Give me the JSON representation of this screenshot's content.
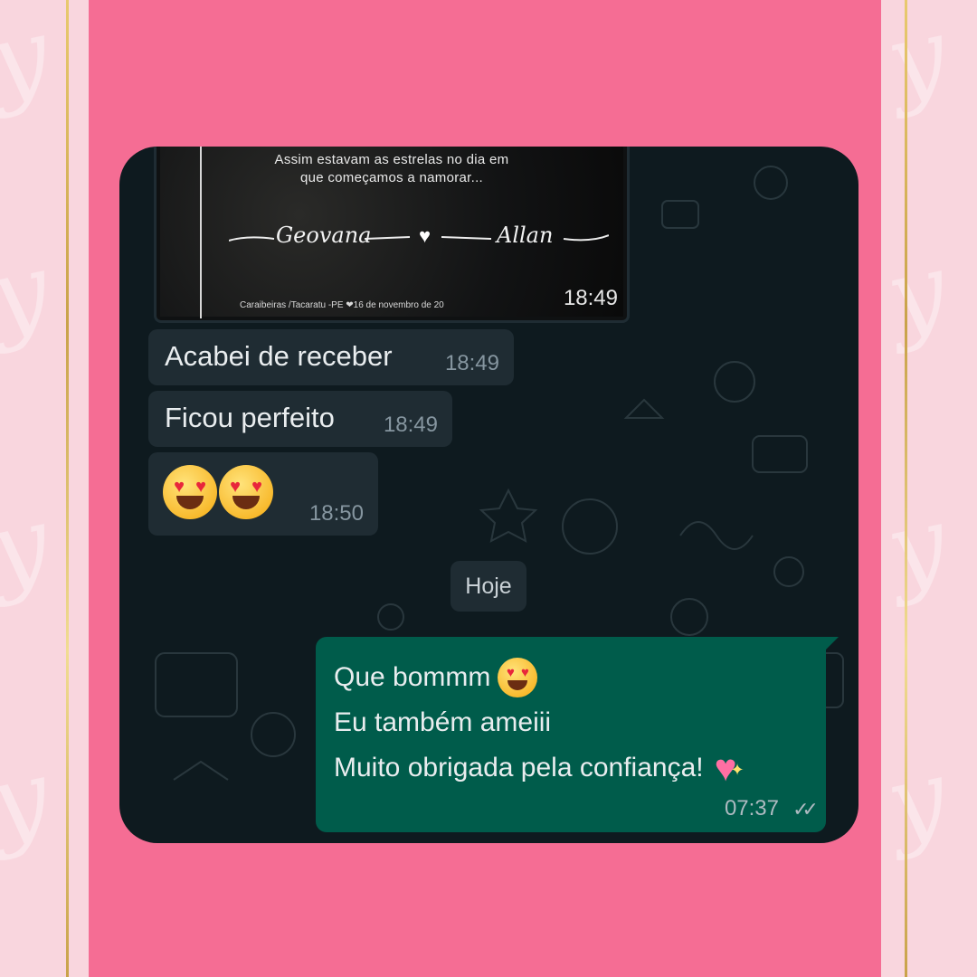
{
  "photo": {
    "caption_line1": "Assim estavam as estrelas no dia em",
    "caption_line2": "que começamos a namorar...",
    "name_left": "Geovana",
    "name_right": "Allan",
    "place": "Caraibeiras /Tacaratu -PE ❤16 de novembro de 20",
    "time": "18:49"
  },
  "messages": {
    "incoming": [
      {
        "text": "Acabei de receber",
        "time": "18:49"
      },
      {
        "text": "Ficou perfeito",
        "time": "18:49"
      },
      {
        "emoji": "heart-eyes-face x2",
        "time": "18:50"
      }
    ],
    "date_chip": "Hoje",
    "outgoing": {
      "line1": "Que bommm",
      "line2": "Eu também ameiii",
      "line3": "Muito obrigada pela confiança!",
      "time": "07:37",
      "status_icon": "double-check-icon"
    }
  },
  "colors": {
    "pink_panel": "#f56d94",
    "chat_background": "#0e1a1f",
    "incoming_bubble": "#1f2c33",
    "outgoing_bubble": "#005c4b",
    "gold_line": "#c9a24a"
  }
}
